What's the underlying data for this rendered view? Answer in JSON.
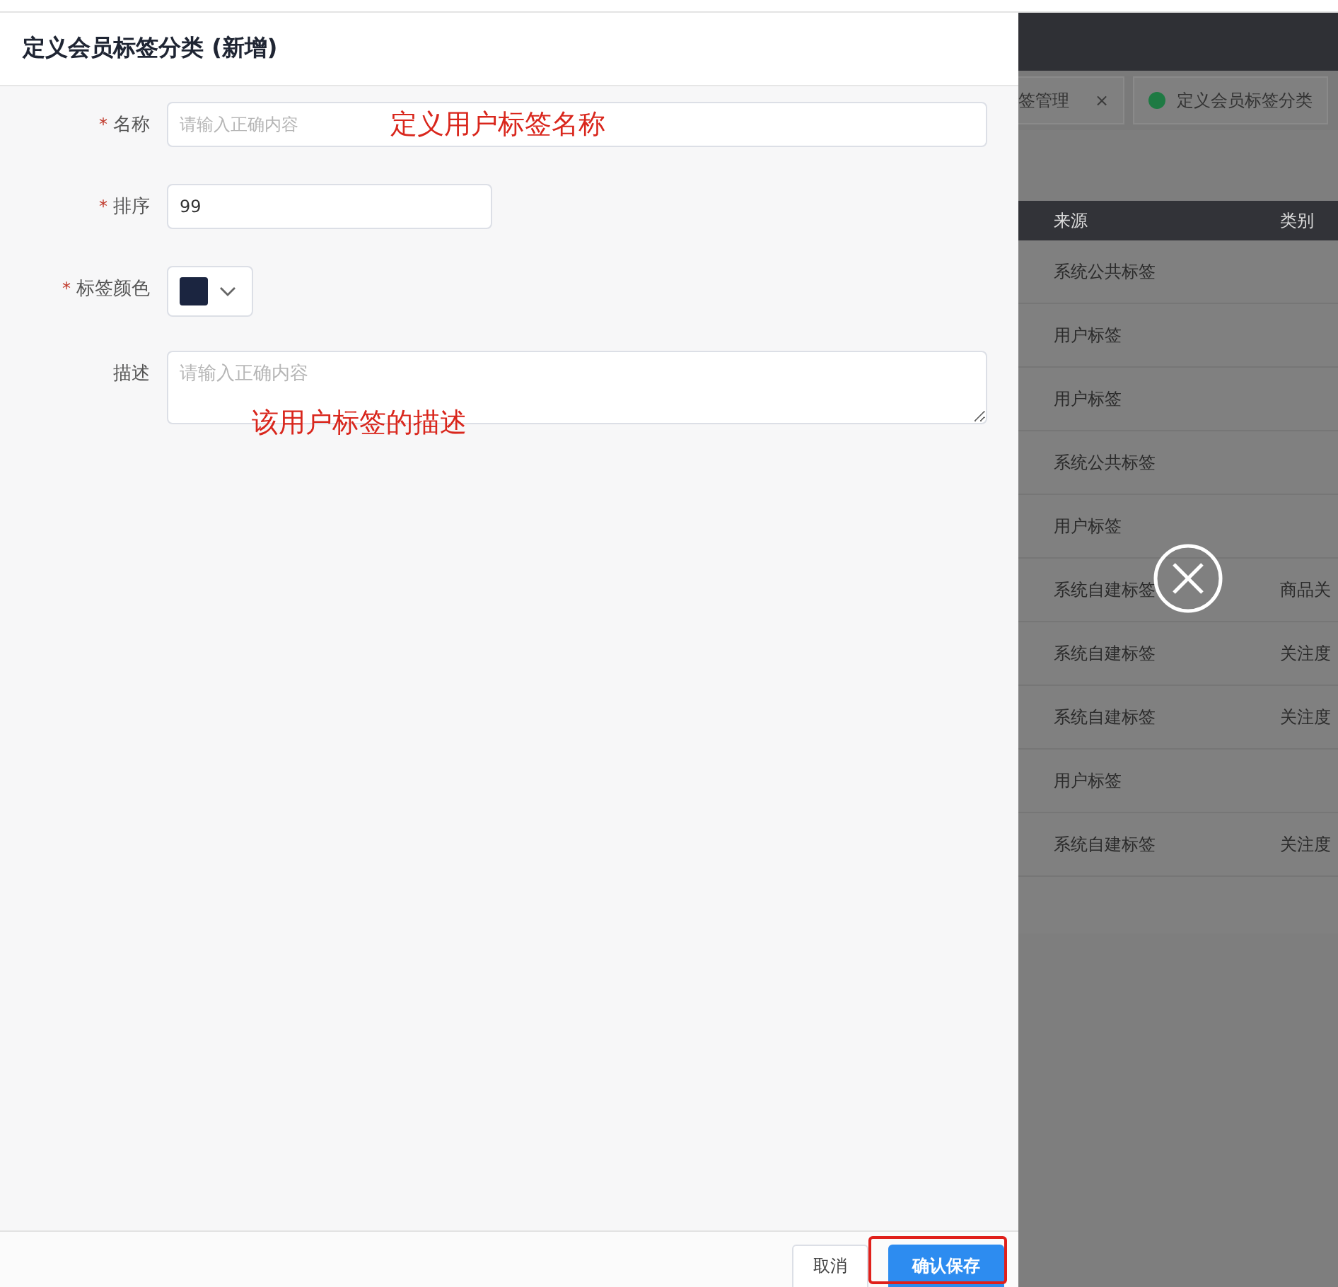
{
  "drawer": {
    "title": "定义会员标签分类 (新增)",
    "fields": [
      {
        "kind": "input",
        "label": "名称",
        "required_mark": "*",
        "placeholder": "请输入正确内容",
        "annotation": "定义用户标签名称"
      },
      {
        "kind": "input",
        "label": "排序",
        "required_mark": "*",
        "value": "99"
      },
      {
        "kind": "color",
        "label": "标签颜色",
        "required_mark": "*",
        "color": "#1b2540"
      },
      {
        "kind": "textarea",
        "label": "描述",
        "placeholder": "请输入正确内容",
        "annotation": "该用户标签的描述"
      }
    ],
    "buttons": [
      {
        "label": "取消",
        "kind": "default",
        "highlighted": false
      },
      {
        "label": "确认保存",
        "kind": "primary",
        "highlighted": true
      }
    ]
  },
  "background": {
    "tabs": [
      {
        "label": "签管理",
        "dot": false,
        "close": "×"
      },
      {
        "label": "定义会员标签分类",
        "dot": true
      }
    ],
    "table": {
      "columns": [
        "来源",
        "类别"
      ],
      "rows": [
        {
          "source": "系统公共标签"
        },
        {
          "source": "用户标签"
        },
        {
          "source": "用户标签"
        },
        {
          "source": "系统公共标签"
        },
        {
          "source": "用户标签"
        },
        {
          "source": "系统自建标签",
          "category": "商品关"
        },
        {
          "source": "系统自建标签",
          "category": "关注度"
        },
        {
          "source": "系统自建标签",
          "category": "关注度"
        },
        {
          "source": "用户标签"
        },
        {
          "source": "系统自建标签",
          "category": "关注度"
        }
      ]
    }
  }
}
